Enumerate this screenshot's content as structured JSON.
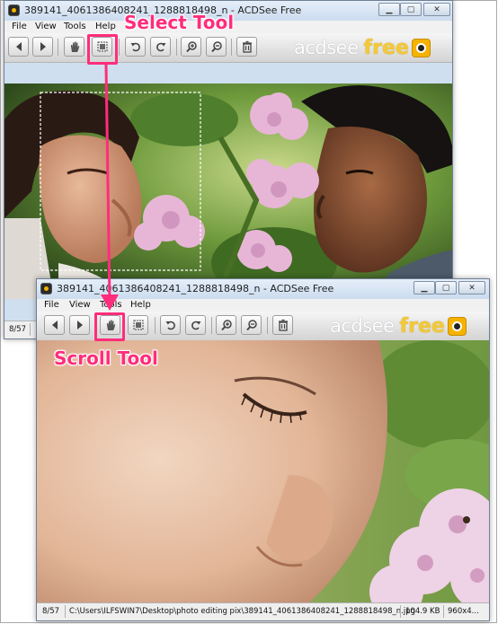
{
  "window_back": {
    "title": "389141_4061386408241_1288818498_n - ACDSee Free",
    "menu": [
      "File",
      "View",
      "Tools",
      "Help"
    ],
    "status": {
      "index": "8/57"
    }
  },
  "window_front": {
    "title": "389141_4061386408241_1288818498_n - ACDSee Free",
    "menu": [
      "File",
      "View",
      "Tools",
      "Help"
    ],
    "status": {
      "index": "8/57",
      "path": "C:\\Users\\ILFSWIN7\\Desktop\\photo editing pix\\389141_4061386408241_1288818498_n.jpg",
      "size": "104.9 KB",
      "dimensions": "960x4..."
    }
  },
  "brand": {
    "left": "acdsee",
    "right": "free"
  },
  "annotations": {
    "select": "Select Tool",
    "scroll": "Scroll Tool"
  },
  "colors": {
    "highlight": "#ff2d7b",
    "brand_yellow": "#f3c93a"
  },
  "toolbar_icons": [
    "back-arrow-icon",
    "forward-arrow-icon",
    "hand-icon",
    "select-icon",
    "rotate-left-icon",
    "rotate-right-icon",
    "zoom-in-icon",
    "zoom-out-icon",
    "trash-icon"
  ]
}
